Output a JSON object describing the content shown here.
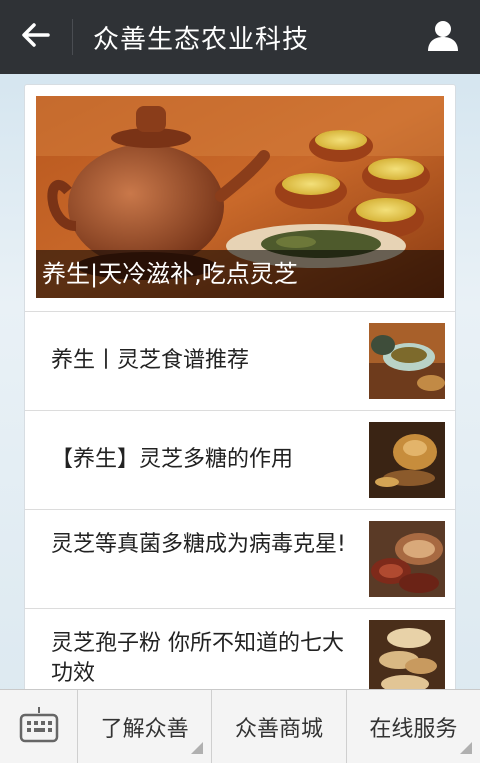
{
  "header": {
    "title": "众善生态农业科技",
    "back_icon": "arrow-left-icon",
    "profile_icon": "user-icon"
  },
  "hero": {
    "caption": "养生|天冷滋补,吃点灵芝"
  },
  "articles": [
    {
      "title": "养生丨灵芝食谱推荐"
    },
    {
      "title": "【养生】灵芝多糖的作用"
    },
    {
      "title": "灵芝等真菌多糖成为病毒克星!"
    },
    {
      "title": "灵芝孢子粉 你所不知道的七大功效"
    }
  ],
  "menu": {
    "keyboard_icon": "keyboard-icon",
    "items": [
      {
        "label": "了解众善"
      },
      {
        "label": "众善商城"
      },
      {
        "label": "在线服务"
      }
    ]
  },
  "colors": {
    "topbar": "#2f3236",
    "background": "#dbe8f0",
    "card": "#ffffff"
  }
}
